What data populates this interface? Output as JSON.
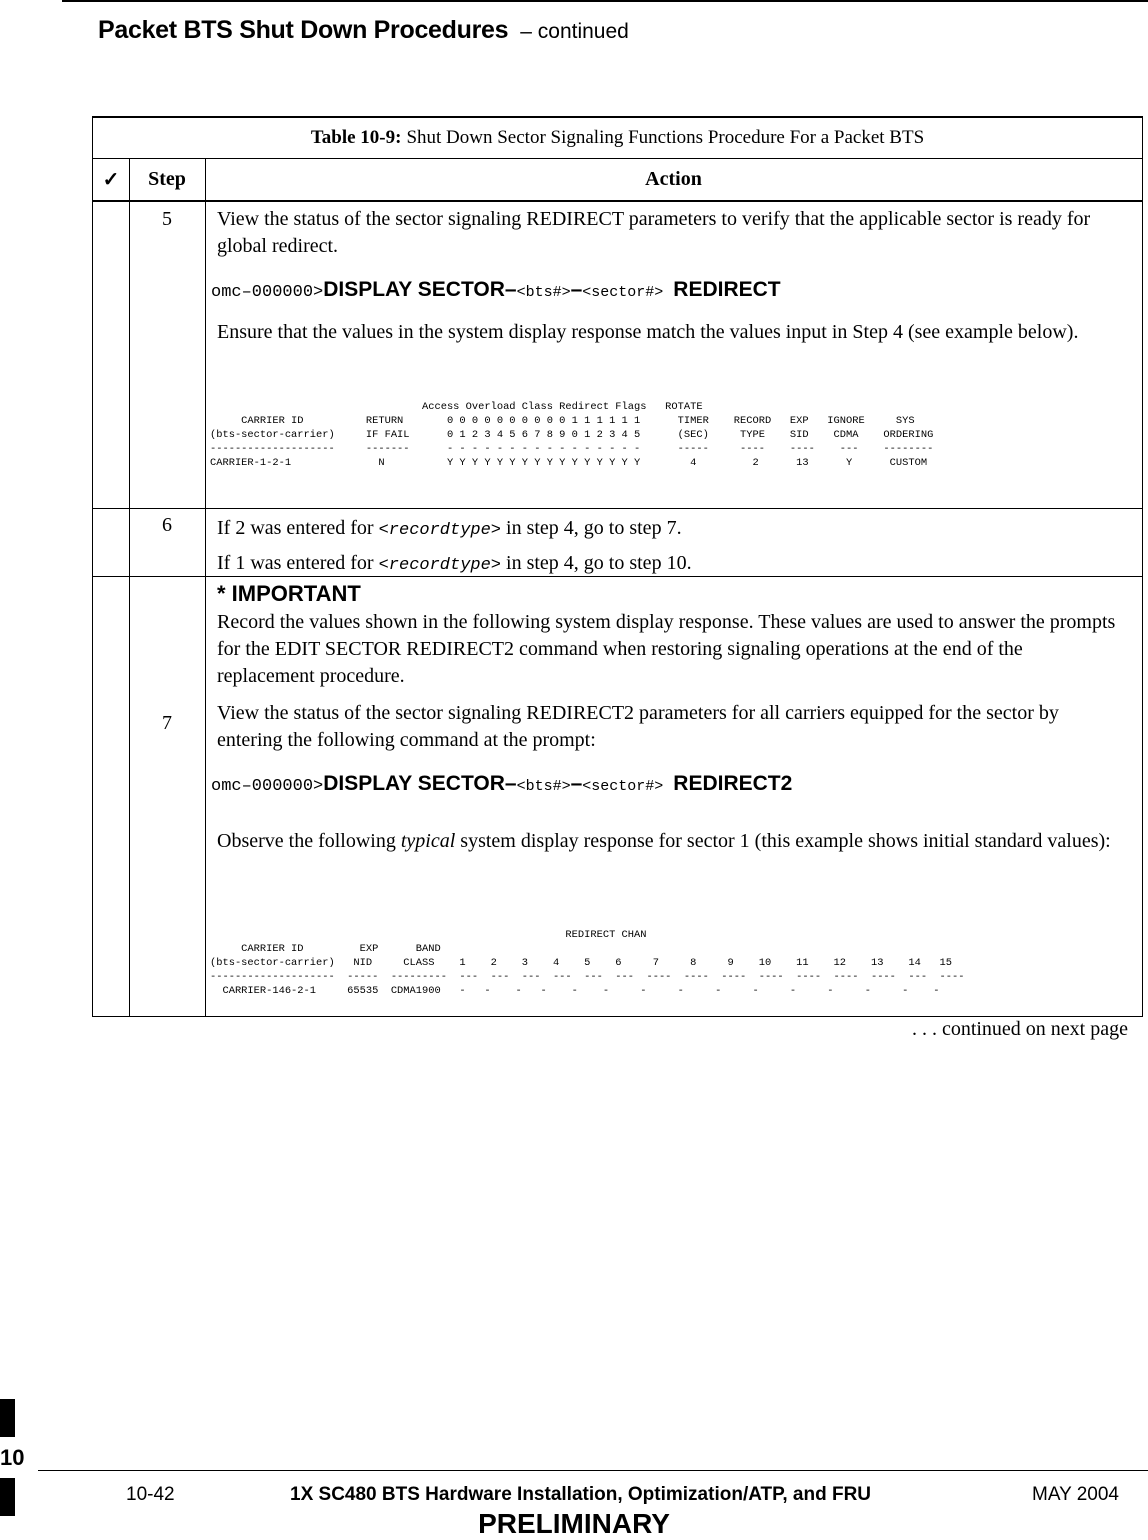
{
  "header": {
    "title": "Packet BTS Shut Down Procedures",
    "subtitle": "– continued"
  },
  "table": {
    "caption_label": "Table 10-9:",
    "caption_text": "Shut Down Sector Signaling Functions Procedure For a Packet BTS",
    "col_check": "✓",
    "col_step": "Step",
    "col_action": "Action",
    "steps": {
      "s5": {
        "number": "5",
        "para1": "View the status of the sector signaling REDIRECT parameters to verify that the applicable sector is ready for global redirect.",
        "cmd_prompt": "omc–000000>",
        "cmd_keyword": "DISPLAY SECTOR–",
        "cmd_arg1": "<bts#>",
        "cmd_dash": "–",
        "cmd_arg2": "<sector#>",
        "cmd_tail": "REDIRECT",
        "para2": "Ensure that the values in the system display response match the values input in Step 4 (see example below).",
        "output": "                                  Access Overload Class Redirect Flags   ROTATE\n     CARRIER ID          RETURN       0 0 0 0 0 0 0 0 0 0 1 1 1 1 1 1      TIMER    RECORD   EXP   IGNORE     SYS\n(bts-sector-carrier)     IF FAIL      0 1 2 3 4 5 6 7 8 9 0 1 2 3 4 5      (SEC)     TYPE    SID    CDMA    ORDERING\n--------------------     -------      - - - - - - - - - - - - - - - -      -----     ----    ----    ---    --------\nCARRIER-1-2-1              N          Y Y Y Y Y Y Y Y Y Y Y Y Y Y Y Y        4         2      13      Y      CUSTOM"
      },
      "s6": {
        "number": "6",
        "line1_pre": "If 2 was entered for ",
        "line1_code": "<recordtype>",
        "line1_post": " in step 4, go to step 7.",
        "line2_pre": "If 1 was entered for ",
        "line2_code": "<recordtype>",
        "line2_post": " in step 4, go to step 10."
      },
      "s7": {
        "number": "7",
        "important": "* IMPORTANT",
        "important_text": "Record the values shown in the following system display response. These values are used to answer the prompts for the EDIT SECTOR REDIRECT2 command when restoring signaling operations at the end of the replacement procedure.",
        "para1": "View the status of the sector signaling REDIRECT2 parameters for all carriers equipped for the sector by entering the following command at the prompt:",
        "cmd_prompt": "omc–000000>",
        "cmd_keyword": "DISPLAY SECTOR–",
        "cmd_arg1": "<bts#>",
        "cmd_dash": "–",
        "cmd_arg2": "<sector#>",
        "cmd_tail": "REDIRECT2",
        "para2_pre": "Observe the following ",
        "para2_em": "typical",
        "para2_post": " system display response for sector 1 (this example shows initial standard values):",
        "output": "                                                         REDIRECT CHAN\n     CARRIER ID         EXP      BAND\n(bts-sector-carrier)   NID     CLASS    1    2    3    4    5    6     7     8     9    10    11    12    13    14   15\n--------------------  -----  ---------  ---  ---  ---  ---  ---  ---  ----  ----  ----  ----  ----  ----  ----  ---  ----\n  CARRIER-146-2-1     65535  CDMA1900   -   -    -   -    -    -     -     -     -     -     -     -     -     -    -"
      }
    },
    "continued": ". . . continued on next page"
  },
  "footer": {
    "chapter": "10",
    "page_number": "10-42",
    "doc_title": "1X SC480 BTS Hardware Installation, Optimization/ATP, and FRU",
    "date": "MAY 2004",
    "status": "PRELIMINARY"
  }
}
